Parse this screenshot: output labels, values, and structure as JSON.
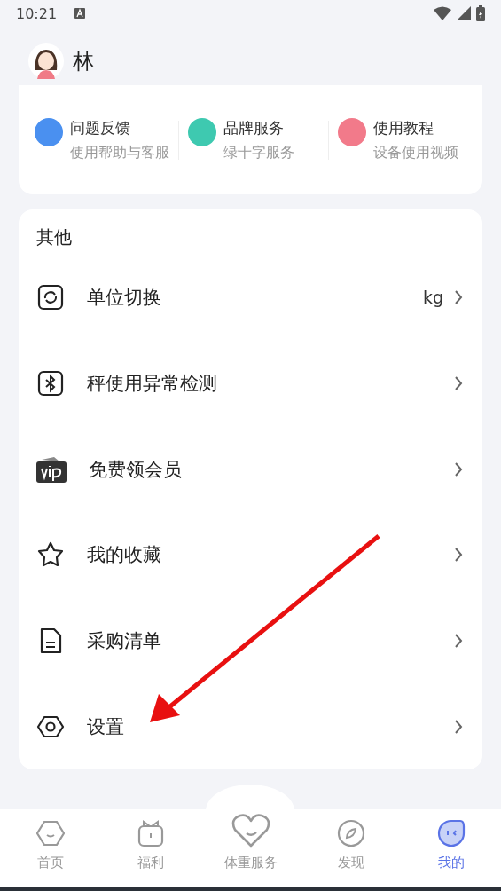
{
  "status_bar": {
    "time": "10:21"
  },
  "profile": {
    "name": "林"
  },
  "services": [
    {
      "title": "问题反馈",
      "subtitle": "使用帮助与客服",
      "color": "#4a90f0"
    },
    {
      "title": "品牌服务",
      "subtitle": "绿十字服务",
      "color": "#3ec9b0"
    },
    {
      "title": "使用教程",
      "subtitle": "设备使用视频",
      "color": "#f27a8a"
    }
  ],
  "other": {
    "heading": "其他",
    "items": [
      {
        "label": "单位切换",
        "value": "kg"
      },
      {
        "label": "秤使用异常检测"
      },
      {
        "label": "免费领会员"
      },
      {
        "label": "我的收藏"
      },
      {
        "label": "采购清单"
      },
      {
        "label": "设置"
      }
    ]
  },
  "tabs": [
    {
      "label": "首页",
      "selected": false
    },
    {
      "label": "福利",
      "selected": false
    },
    {
      "label": "体重服务",
      "selected": false
    },
    {
      "label": "发现",
      "selected": false
    },
    {
      "label": "我的",
      "selected": true
    }
  ]
}
